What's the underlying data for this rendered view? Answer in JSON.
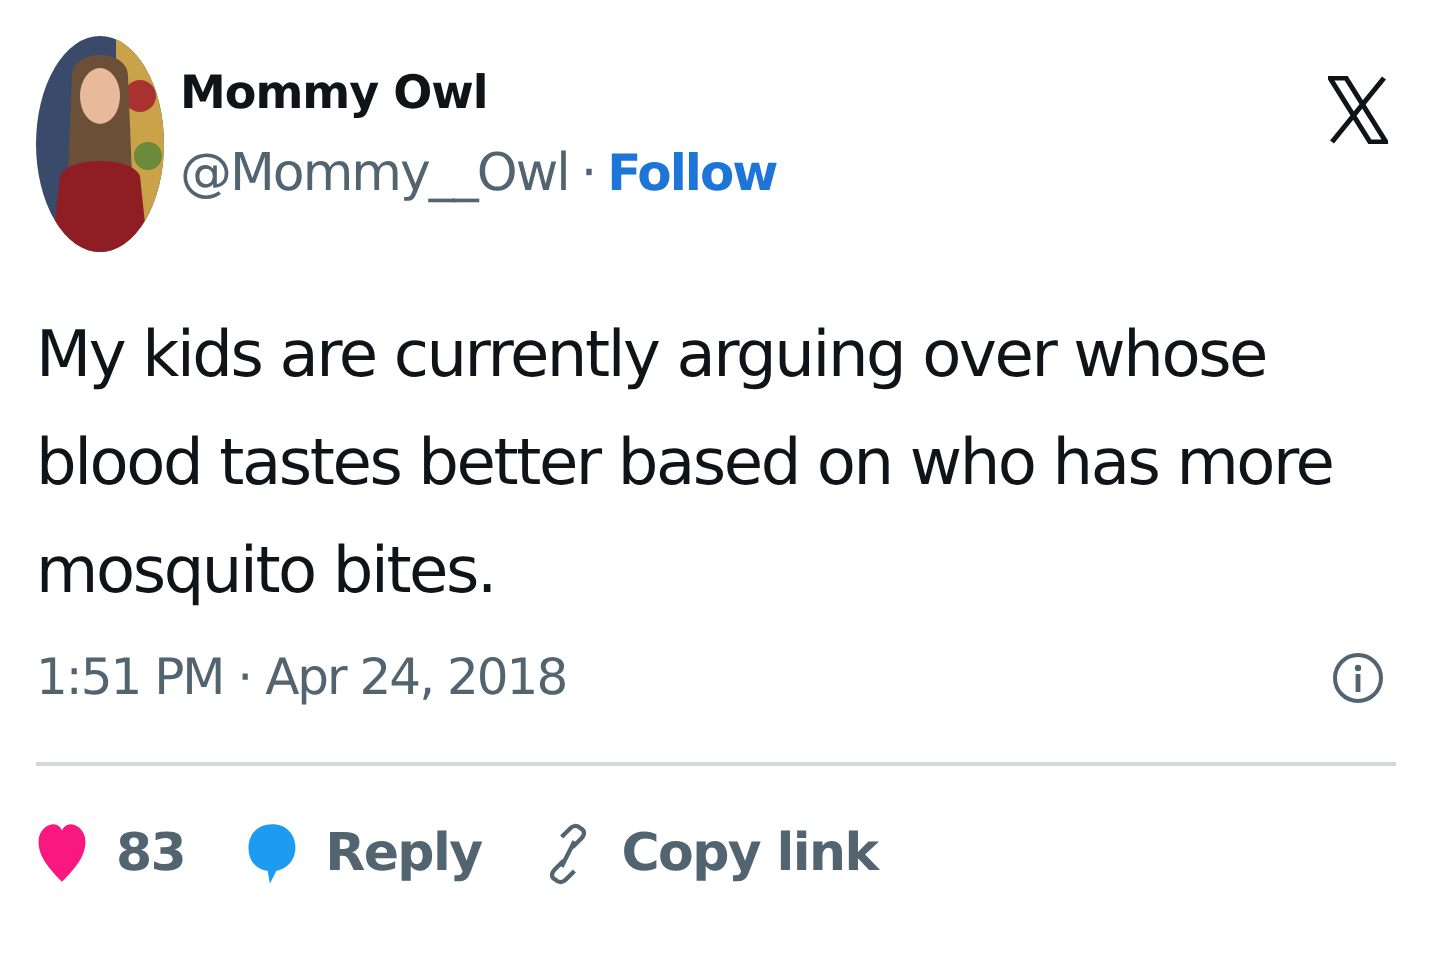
{
  "author": {
    "name": "Mommy Owl",
    "handle": "@Mommy__Owl",
    "separator": "·",
    "follow": "Follow"
  },
  "text": "My kids are currently arguing over whose blood tastes better based on who has more mosquito bites.",
  "timestamp": "1:51 PM · Apr 24, 2018",
  "actions": [
    {
      "kind": "like",
      "label": "83"
    },
    {
      "kind": "reply",
      "label": "Reply"
    },
    {
      "kind": "copy",
      "label": "Copy link"
    }
  ]
}
